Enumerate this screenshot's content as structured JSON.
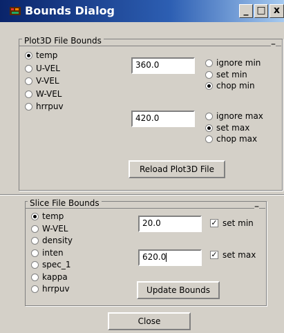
{
  "window": {
    "title": "Bounds Dialog",
    "controls": {
      "minimize": "_",
      "maximize": "□",
      "close": "x"
    }
  },
  "plot3d": {
    "title": "Plot3D File Bounds",
    "collapse": "–",
    "variables": [
      "temp",
      "U-VEL",
      "V-VEL",
      "W-VEL",
      "hrrpuv"
    ],
    "selected": "temp",
    "min_value": "360.0",
    "max_value": "420.0",
    "min_options": [
      "ignore min",
      "set min",
      "chop min"
    ],
    "min_selected": "chop min",
    "max_options": [
      "ignore max",
      "set max",
      "chop max"
    ],
    "max_selected": "set max",
    "reload_label": "Reload Plot3D File"
  },
  "slice": {
    "title": "Slice File Bounds",
    "collapse": "–",
    "variables": [
      "temp",
      "W-VEL",
      "density",
      "inten",
      "spec_1",
      "kappa",
      "hrrpuv"
    ],
    "selected": "temp",
    "min_value": "20.0",
    "max_value": "620.0",
    "set_min_label": "set min",
    "set_min_checked": true,
    "set_max_label": "set max",
    "set_max_checked": true,
    "update_label": "Update Bounds"
  },
  "close_label": "Close"
}
